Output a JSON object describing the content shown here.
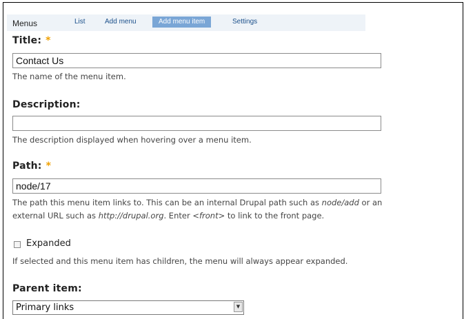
{
  "tabs": {
    "title": "Menus",
    "items": [
      {
        "label": "List"
      },
      {
        "label": "Add menu"
      },
      {
        "label": "Add menu item",
        "active": true
      },
      {
        "label": "Settings"
      }
    ]
  },
  "form": {
    "title": {
      "label": "Title:",
      "required_marker": "*",
      "value": "Contact Us",
      "description": "The name of the menu item."
    },
    "description": {
      "label": "Description:",
      "value": "",
      "description": "The description displayed when hovering over a menu item."
    },
    "path": {
      "label": "Path:",
      "required_marker": "*",
      "value": "node/17",
      "description_parts": [
        "The path this menu item links to. This can be an internal Drupal path such as ",
        "node/add",
        " or an",
        "external URL such as ",
        "http://drupal.org",
        ". Enter ",
        "<front>",
        " to link to the front page."
      ]
    },
    "expanded": {
      "label": "Expanded",
      "checked": false,
      "description": "If selected and this menu item has children, the menu will always appear expanded."
    },
    "parent": {
      "label": "Parent item:",
      "value": "Primary links",
      "arrow_icon": "dropdown-arrow-icon"
    }
  },
  "colors": {
    "active_tab_bg": "#7aa6d6",
    "tab_link": "#1a4f8a",
    "required": "#f0a000"
  }
}
